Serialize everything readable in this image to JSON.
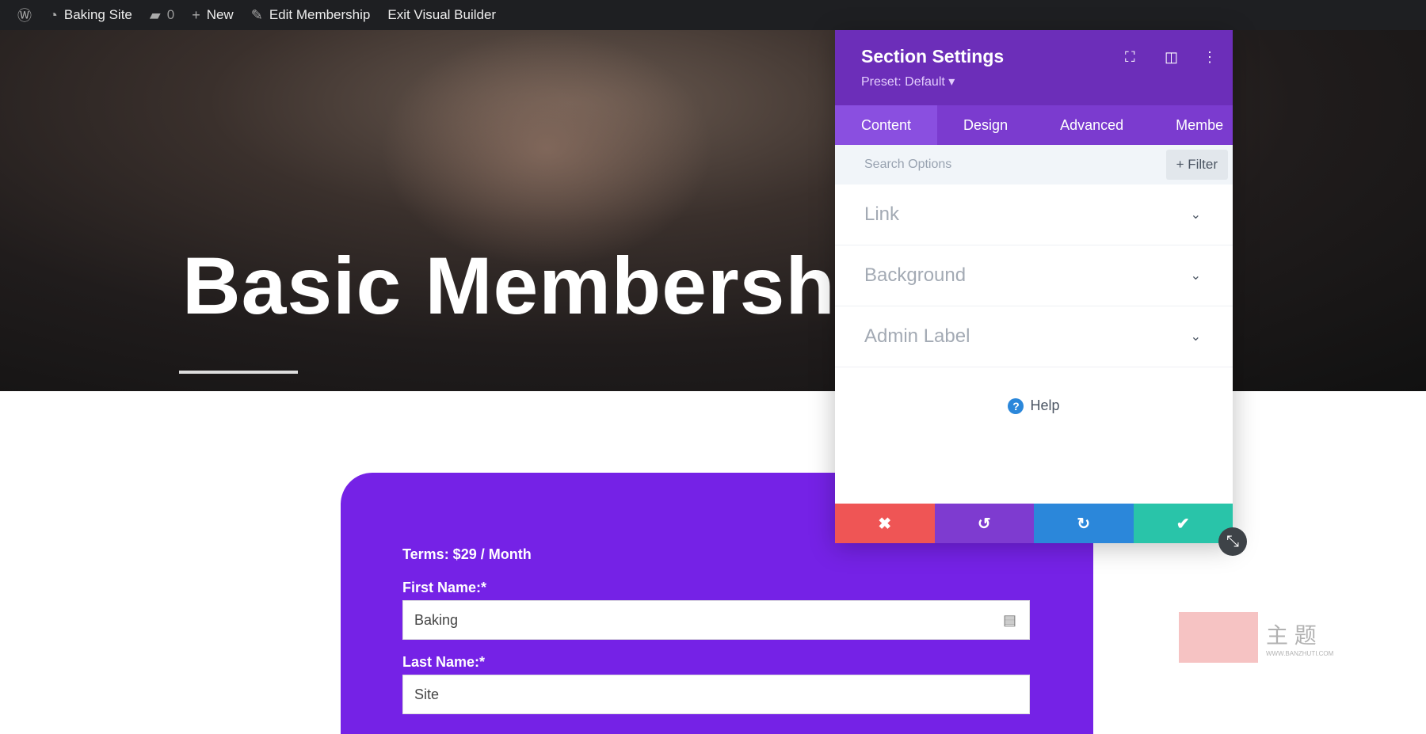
{
  "adminbar": {
    "site": "Baking Site",
    "comments": "0",
    "new": "New",
    "edit": "Edit Membership",
    "exit": "Exit Visual Builder"
  },
  "hero": {
    "title": "Basic Membersh"
  },
  "form": {
    "terms": "Terms: $29 / Month",
    "first_label": "First Name:*",
    "first_value": "Baking",
    "last_label": "Last Name:*",
    "last_value": "Site"
  },
  "panel": {
    "title": "Section Settings",
    "preset": "Preset: Default ▾",
    "tabs": [
      "Content",
      "Design",
      "Advanced",
      "Membe"
    ],
    "search_placeholder": "Search Options",
    "filter": "+ Filter",
    "rows": [
      "Link",
      "Background",
      "Admin Label"
    ],
    "help": "Help",
    "colors": {
      "cancel": "#ef5555",
      "undo": "#7e3bd0",
      "redo": "#2b87da",
      "save": "#29c4a9"
    }
  },
  "watermark": {
    "text": "主 题",
    "url": "WWW.BANZHUTI.COM"
  }
}
